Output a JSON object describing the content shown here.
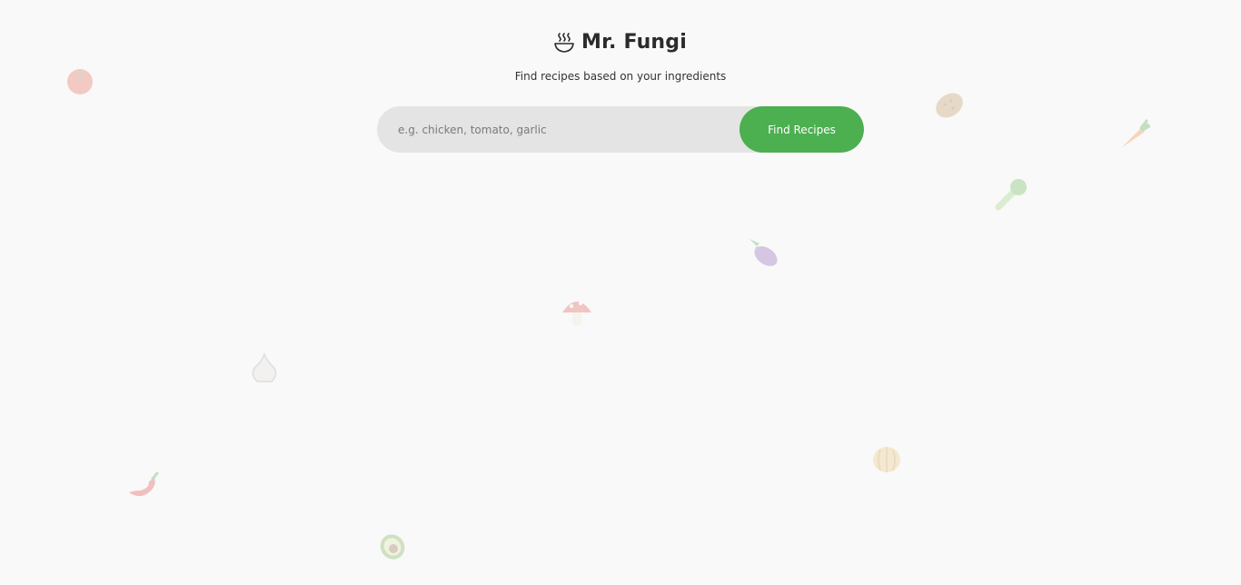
{
  "header": {
    "icon": "steaming-bowl-icon",
    "title": "Mr. Fungi",
    "subtitle": "Find recipes based on your ingredients"
  },
  "search": {
    "placeholder": "e.g. chicken, tomato, garlic",
    "value": "",
    "button_label": "Find Recipes"
  },
  "colors": {
    "background": "#f9f9f9",
    "search_field": "#e4e4e4",
    "accent": "#4caf50",
    "title_text": "#2b2b2b"
  },
  "background_decorations": [
    "tomato-icon",
    "potato-icon",
    "carrot-icon",
    "leafy-green-icon",
    "eggplant-icon",
    "mushroom-icon",
    "garlic-icon",
    "onion-icon",
    "chili-pepper-icon",
    "avocado-icon"
  ]
}
